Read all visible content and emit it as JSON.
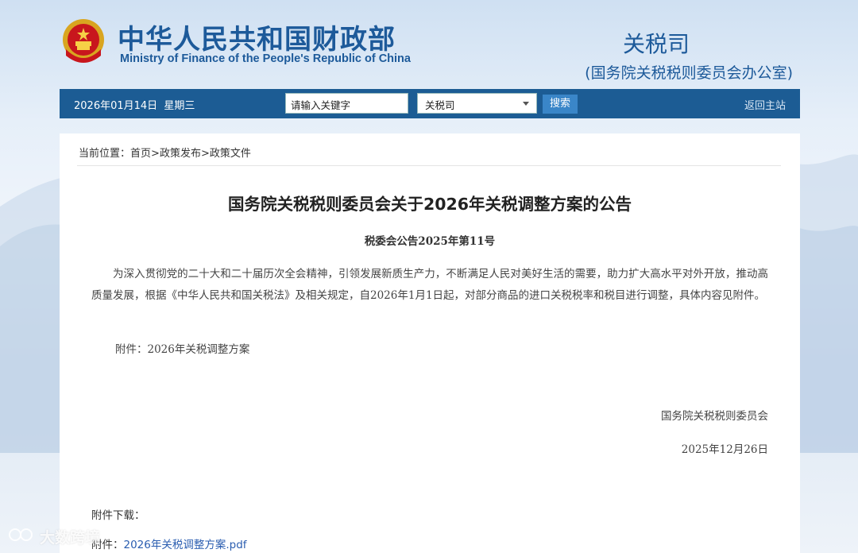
{
  "header": {
    "ministry_cn": "中华人民共和国财政部",
    "ministry_en": "Ministry of Finance of the People's Republic of China",
    "dept_name": "关税司",
    "dept_sub": "(国务院关税税则委员会办公室)"
  },
  "navbar": {
    "date": "2026年01月14日  星期三",
    "search_placeholder": "请输入关键字",
    "select_value": "关税司",
    "search_button": "搜索",
    "home_link": "返回主站"
  },
  "breadcrumb": {
    "prefix": "当前位置：",
    "items": [
      "首页",
      "政策发布",
      "政策文件"
    ],
    "separator": ">"
  },
  "article": {
    "title": "国务院关税税则委员会关于2026年关税调整方案的公告",
    "number": "税委会公告2025年第11号",
    "body": "为深入贯彻党的二十大和二十届历次全会精神，引领发展新质生产力，不断满足人民对美好生活的需要，助力扩大高水平对外开放，推动高质量发展，根据《中华人民共和国关税法》及相关规定，自2026年1月1日起，对部分商品的进口关税税率和税目进行调整，具体内容见附件。",
    "attachment_note": "附件：2026年关税调整方案",
    "signer": "国务院关税税则委员会",
    "date": "2025年12月26日"
  },
  "downloads": {
    "label": "附件下载：",
    "link_prefix": "附件：",
    "link_text": "2026年关税调整方案.pdf"
  },
  "watermark": "大数跨境",
  "colors": {
    "brand_blue": "#1d5a9a",
    "nav_bg": "#1c5c94",
    "button_bg": "#3a86c8",
    "link": "#2a5db0"
  }
}
